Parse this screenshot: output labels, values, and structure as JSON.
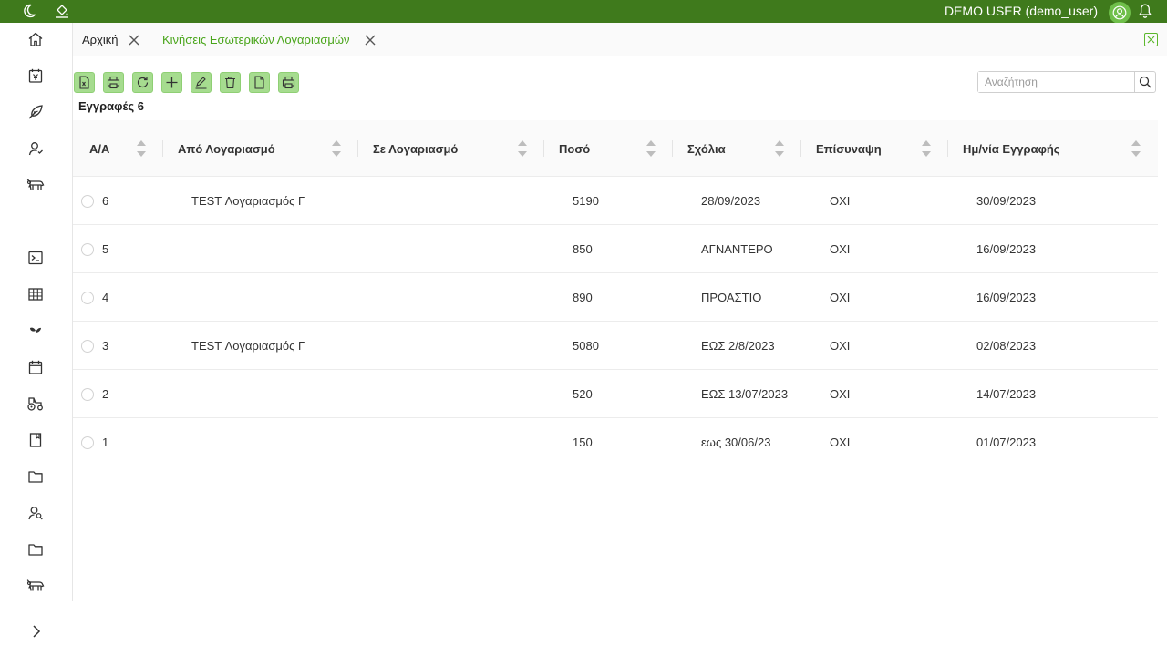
{
  "topbar": {
    "user_label": "DEMO USER (demo_user)",
    "icons": [
      "moon-icon",
      "paint-bucket-icon",
      "user-avatar-icon",
      "bell-icon"
    ],
    "bg_color": "#3f7a1c"
  },
  "sidebar": {
    "icons": [
      "home-icon",
      "calendar-money-icon",
      "leaf-icon",
      "user-settings-icon",
      "cattle-icon",
      "terminal-icon",
      "table-icon",
      "plant-icon",
      "calendar-icon",
      "tractor-icon",
      "book-icon",
      "folder-icon",
      "user-search-icon",
      "folder-icon",
      "cattle-icon",
      "chevron-right-icon"
    ]
  },
  "tabs": [
    {
      "label": "Αρχική",
      "active": false
    },
    {
      "label": "Κινήσεις Εσωτερικών Λογαριασμών",
      "active": true
    }
  ],
  "toolbar": {
    "buttons": [
      "excel-export-button",
      "print-button",
      "refresh-button",
      "add-button",
      "edit-button",
      "delete-button",
      "document-button",
      "print-alt-button"
    ]
  },
  "search": {
    "placeholder": "Αναζήτηση"
  },
  "records": {
    "label": "Εγγραφές 6"
  },
  "table": {
    "columns": [
      "Α/Α",
      "Από Λογαριασμό",
      "Σε Λογαριασμό",
      "Ποσό",
      "Σχόλια",
      "Επίσυναψη",
      "Ημ/νία Εγγραφής"
    ],
    "rows": [
      [
        "6",
        "TEST Λογαριασμός Γ",
        "",
        "5190",
        "28/09/2023",
        "ΟΧΙ",
        "30/09/2023"
      ],
      [
        "5",
        "",
        "",
        "850",
        "ΑΓΝΑΝΤΕΡΟ",
        "ΟΧΙ",
        "16/09/2023"
      ],
      [
        "4",
        "",
        "",
        "890",
        "ΠΡΟΑΣΤΙΟ",
        "ΟΧΙ",
        "16/09/2023"
      ],
      [
        "3",
        "TEST Λογαριασμός Γ",
        "",
        "5080",
        "ΕΩΣ 2/8/2023",
        "ΟΧΙ",
        "02/08/2023"
      ],
      [
        "2",
        "",
        "",
        "520",
        "ΕΩΣ 13/07/2023",
        "ΟΧΙ",
        "14/07/2023"
      ],
      [
        "1",
        "",
        "",
        "150",
        "εως 30/06/23",
        "ΟΧΙ",
        "01/07/2023"
      ]
    ]
  },
  "colors": {
    "accent": "#49a51a",
    "button_bg": "#a6dc8f",
    "topbar": "#3f7a1c"
  }
}
